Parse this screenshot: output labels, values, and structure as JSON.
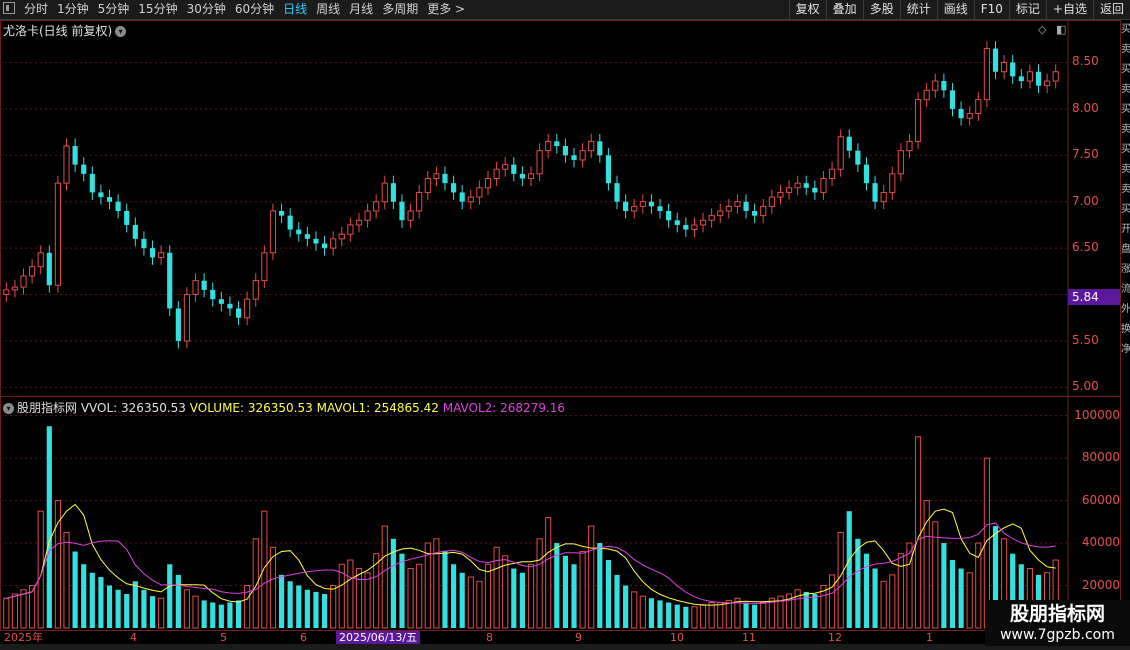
{
  "toolbar": {
    "periods": [
      "分时",
      "1分钟",
      "5分钟",
      "15分钟",
      "30分钟",
      "60分钟",
      "日线",
      "周线",
      "月线",
      "多周期",
      "更多 >"
    ],
    "active_period": "日线",
    "actions": [
      "复权",
      "叠加",
      "多股",
      "统计",
      "画线",
      "F10",
      "标记",
      "+自选",
      "返回"
    ]
  },
  "chart_title": "尤洛卡(日线 前复权)",
  "price_axis": {
    "labels": [
      "8.50",
      "8.00",
      "7.50",
      "7.00",
      "6.50",
      "6.00",
      "5.50",
      "5.00"
    ],
    "range": [
      4.95,
      8.85
    ]
  },
  "current_price": "5.84",
  "indicator": {
    "name": "股朋指标网",
    "vvol": "VVOL: 326350.53",
    "volume": "VOLUME: 326350.53",
    "mavol1": "MAVOL1: 254865.42",
    "mavol2": "MAVOL2: 268279.16"
  },
  "volume_axis": {
    "labels": [
      "100000",
      "80000",
      "60000",
      "40000",
      "20000"
    ],
    "max": 105000
  },
  "date_axis": [
    "2025年",
    "4",
    "5",
    "6",
    "2025/06/13/五",
    "8",
    "9",
    "10",
    "11",
    "12",
    "1"
  ],
  "right_strip": [
    "买",
    "卖",
    "买",
    "卖",
    "买",
    "卖",
    "买",
    "卖",
    "卖",
    "买",
    "开",
    "盘",
    "涨",
    "流",
    "外",
    "换",
    "净"
  ],
  "watermark": {
    "title": "股朋指标网",
    "url": "www.7gpzb.com"
  },
  "colors": {
    "up": "#e34b4b",
    "down": "#33e0e0",
    "mavol1": "#ffff40",
    "mavol2": "#e040e0",
    "grid": "#5a1616",
    "active": "#36c9ff",
    "highlight": "#5a189a"
  },
  "chart_data": {
    "type": "candlestick+volume",
    "title": "尤洛卡(日线 前复权)",
    "closes": [
      6.05,
      6.08,
      6.2,
      6.3,
      6.45,
      6.1,
      7.2,
      7.6,
      7.4,
      7.3,
      7.1,
      7.05,
      7.0,
      6.9,
      6.75,
      6.6,
      6.5,
      6.4,
      6.45,
      5.85,
      5.5,
      6.0,
      6.15,
      6.05,
      5.95,
      5.9,
      5.85,
      5.75,
      5.95,
      6.15,
      6.45,
      6.9,
      6.85,
      6.7,
      6.65,
      6.6,
      6.55,
      6.5,
      6.6,
      6.65,
      6.75,
      6.8,
      6.9,
      7.0,
      7.2,
      7.0,
      6.8,
      6.9,
      7.1,
      7.25,
      7.3,
      7.2,
      7.1,
      7.0,
      7.05,
      7.15,
      7.25,
      7.35,
      7.4,
      7.3,
      7.25,
      7.3,
      7.55,
      7.65,
      7.6,
      7.5,
      7.45,
      7.55,
      7.65,
      7.5,
      7.2,
      7.0,
      6.9,
      6.95,
      7.0,
      6.95,
      6.9,
      6.8,
      6.75,
      6.7,
      6.75,
      6.8,
      6.85,
      6.9,
      6.95,
      7.0,
      6.9,
      6.85,
      6.95,
      7.05,
      7.1,
      7.15,
      7.2,
      7.15,
      7.1,
      7.25,
      7.35,
      7.7,
      7.55,
      7.4,
      7.2,
      7.0,
      7.1,
      7.3,
      7.55,
      7.65,
      8.1,
      8.2,
      8.3,
      8.2,
      8.0,
      7.9,
      7.95,
      8.1,
      8.65,
      8.4,
      8.5,
      8.35,
      8.3,
      8.4,
      8.25,
      8.3,
      8.4
    ],
    "volumes": [
      14000,
      16000,
      18000,
      20000,
      55000,
      95000,
      60000,
      45000,
      36000,
      30000,
      26000,
      24000,
      20000,
      18000,
      16000,
      22000,
      18000,
      15000,
      14000,
      30000,
      25000,
      18000,
      15000,
      13000,
      12000,
      11000,
      12000,
      13000,
      20000,
      42000,
      55000,
      38000,
      25000,
      22000,
      20000,
      18000,
      17000,
      16000,
      20000,
      30000,
      32000,
      28000,
      26000,
      35000,
      48000,
      42000,
      35000,
      28000,
      30000,
      40000,
      42000,
      36000,
      30000,
      26000,
      24000,
      22000,
      30000,
      38000,
      34000,
      28000,
      26000,
      30000,
      42000,
      52000,
      40000,
      34000,
      30000,
      36000,
      48000,
      40000,
      32000,
      25000,
      20000,
      17000,
      15000,
      14000,
      13000,
      12000,
      11000,
      10000,
      10000,
      11000,
      12000,
      12000,
      13000,
      14000,
      12000,
      11000,
      12000,
      14000,
      15000,
      16000,
      18000,
      17000,
      16000,
      20000,
      25000,
      45000,
      55000,
      42000,
      35000,
      28000,
      22000,
      25000,
      35000,
      40000,
      90000,
      60000,
      50000,
      40000,
      32000,
      28000,
      26000,
      40000,
      80000,
      48000,
      42000,
      35000,
      30000,
      28000,
      25000,
      26000,
      32000
    ],
    "ylim": [
      4.95,
      8.85
    ],
    "volume_ylim": [
      0,
      105000
    ]
  }
}
